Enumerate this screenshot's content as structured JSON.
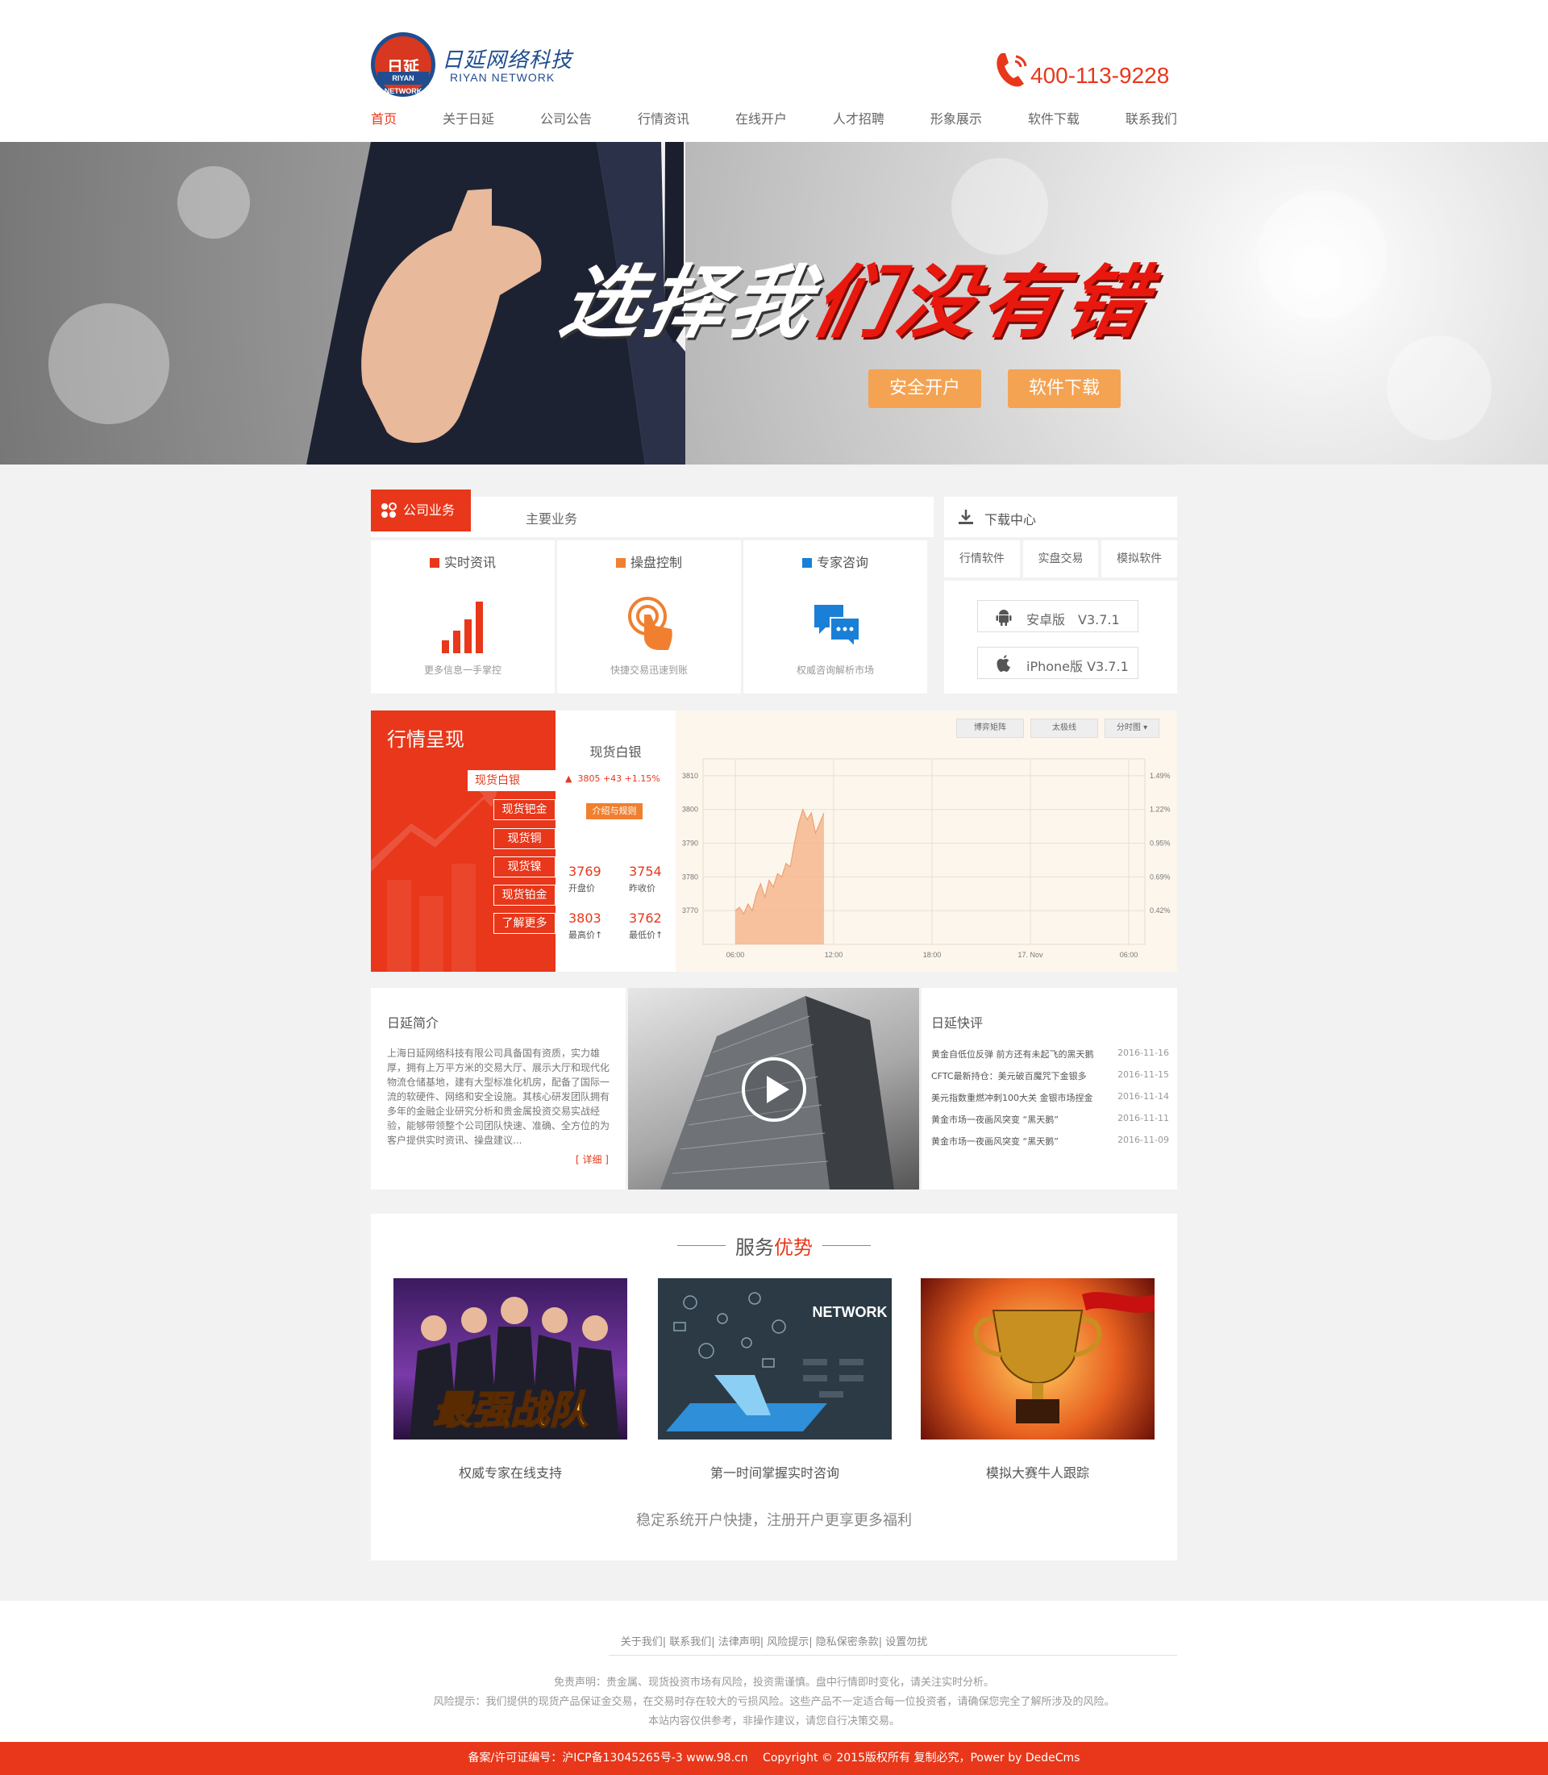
{
  "brand": {
    "badge_text": "日延",
    "badge_band": "RIYAN NETWORK",
    "name_cn": "日延网络科技",
    "name_en": "RIYAN NETWORK",
    "accent_color": "#e8371a",
    "logo_blue": "#1f4d8f"
  },
  "header": {
    "phone": "400-113-9228",
    "nav": [
      "首页",
      "关于日延",
      "公司公告",
      "行情资讯",
      "在线开户",
      "人才招聘",
      "形象展示",
      "软件下载",
      "联系我们"
    ],
    "active_nav": "首页"
  },
  "banner": {
    "slogan_white": "选择我",
    "slogan_red": "们没有错",
    "buttons": [
      "安全开户",
      "软件下载"
    ]
  },
  "business": {
    "tab": "公司业务",
    "subtitle": "主要业务",
    "cards": [
      {
        "title": "实时资讯",
        "desc": "更多信息一手掌控",
        "color": "#e8371a",
        "icon": "bar-chart-icon"
      },
      {
        "title": "操盘控制",
        "desc": "快捷交易迅速到账",
        "color": "#f08030",
        "icon": "touch-icon"
      },
      {
        "title": "专家咨询",
        "desc": "权威咨询解析市场",
        "color": "#1a7fd6",
        "icon": "chat-icon"
      }
    ]
  },
  "download": {
    "title": "下载中心",
    "tabs": [
      "行情软件",
      "实盘交易",
      "模拟软件"
    ],
    "items": [
      {
        "label": "安卓版　V3.7.1",
        "icon": "android-icon"
      },
      {
        "label": "iPhone版 V3.7.1",
        "icon": "apple-icon"
      }
    ]
  },
  "market": {
    "title": "行情呈现",
    "tabs": [
      "现货白银",
      "现货钯金",
      "现货铜",
      "现货镍",
      "现货铂金",
      "了解更多"
    ],
    "active_tab": "现货白银",
    "name": "现货白银",
    "change": "3805 +43 +1.15%",
    "intro_btn": "介绍与规则",
    "open": "3769",
    "open_label": "开盘价",
    "prev_close": "3754",
    "prev_close_label": "昨收价",
    "low": "3803",
    "low_label": "最高价↑",
    "low2": "3762",
    "low2_label": "最低价↑",
    "chart_buttons": [
      "博弈矩阵",
      "太极线",
      "分时图"
    ]
  },
  "chart_data": {
    "type": "area",
    "x": [
      "06:00",
      "12:00",
      "18:00",
      "17. Nov",
      "06:00"
    ],
    "y_ticks": [
      3770,
      3780,
      3790,
      3800,
      3810
    ],
    "y2_ticks": [
      "0.42%",
      "0.69%",
      "0.95%",
      "1.22%",
      "1.49%"
    ],
    "ylim": [
      3760,
      3815
    ],
    "series": [
      {
        "values": [
          3770,
          3771,
          3769,
          3772,
          3770,
          3775,
          3778,
          3774,
          3779,
          3777,
          3781,
          3780,
          3784,
          3783,
          3790,
          3796,
          3800,
          3797,
          3799,
          3793,
          3796,
          3799
        ]
      }
    ],
    "grid": true,
    "color": "#f5b48a"
  },
  "intro": {
    "title": "日延简介",
    "text": "上海日延网络科技有限公司具备国有资质，实力雄厚，拥有上万平方米的交易大厅、展示大厅和现代化物流仓储基地，建有大型标准化机房，配备了国际一流的软硬件、网络和安全设施。其核心研发团队拥有多年的金融企业研究分析和贵金属投资交易实战经验，能够带领整个公司团队快速、准确、全方位的为客户提供实时资讯、操盘建议...",
    "more": "[ 详细 ]"
  },
  "review": {
    "title": "日延快评",
    "news": [
      {
        "title": "黄金自低位反弹 前方还有未起飞的黑天鹅",
        "date": "2016-11-16"
      },
      {
        "title": "CFTC最新持仓：美元破百魔咒下金银多",
        "date": "2016-11-15"
      },
      {
        "title": "美元指数重燃冲刺100大关 金银市场捏金",
        "date": "2016-11-14"
      },
      {
        "title": "黄金市场一夜画风突变 “黑天鹅”",
        "date": "2016-11-11"
      },
      {
        "title": "黄金市场一夜画风突变 “黑天鹅”",
        "date": "2016-11-09"
      }
    ]
  },
  "service": {
    "title_a": "服务",
    "title_b": "优势",
    "items": [
      {
        "caption": "权威专家在线支持",
        "img_text": "最强战队"
      },
      {
        "caption": "第一时间掌握实时咨询",
        "img_text": "NETWORK"
      },
      {
        "caption": "模拟大赛牛人跟踪",
        "img_text": ""
      }
    ],
    "slogan": "稳定系统开户快捷，注册开户更享更多福利"
  },
  "footer": {
    "links": "关于我们| 联系我们| 法律声明| 风险提示| 隐私保密条款| 设置勿扰",
    "note1": "免责声明：贵金属、现货投资市场有风险，投资需谨慎。盘中行情即时变化，请关注实时分析。",
    "note2": "风险提示：我们提供的现货产品保证金交易，在交易时存在较大的亏损风险。这些产品不一定适合每一位投资者，请确保您完全了解所涉及的风险。",
    "note3": "本站内容仅供参考，非操作建议，请您自行决策交易。",
    "copyright": "备案/许可证编号：沪ICP备13045265号-3 www.98.cn　 Copyright © 2015版权所有 复制必究，Power by DedeCms"
  }
}
